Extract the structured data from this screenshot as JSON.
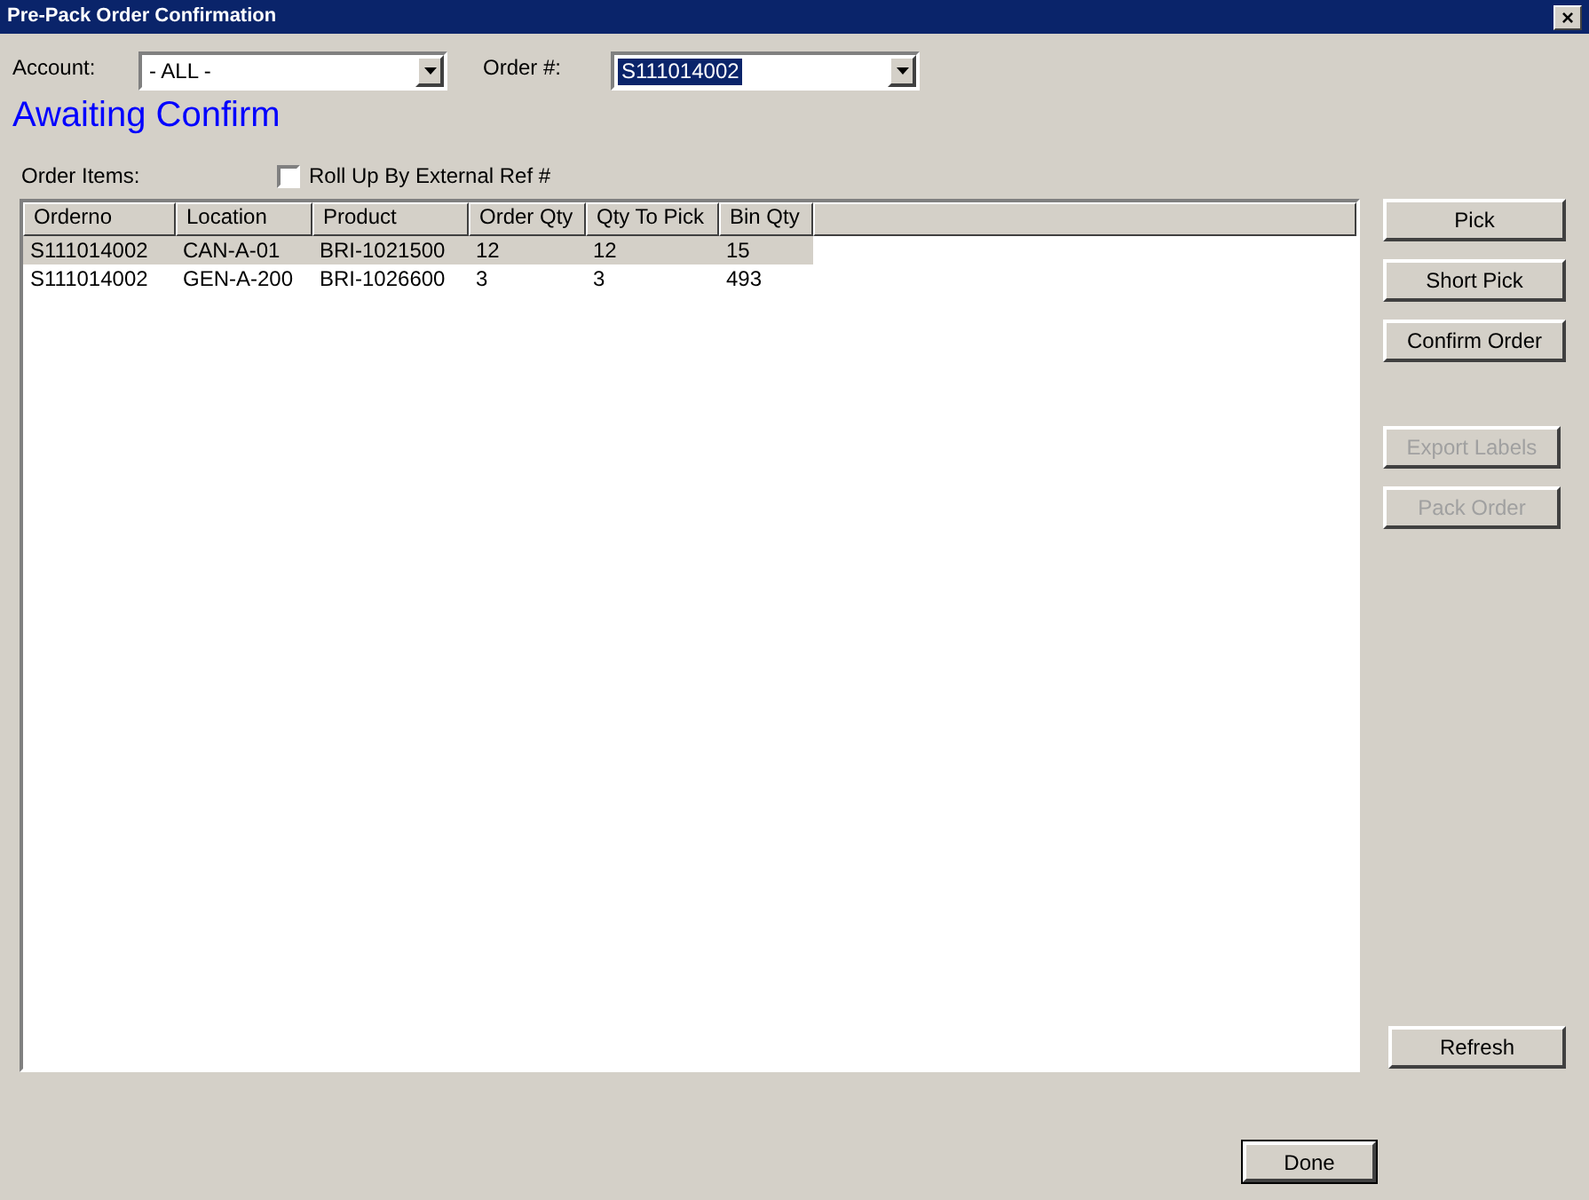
{
  "window": {
    "title": "Pre-Pack Order Confirmation",
    "close": "×"
  },
  "account": {
    "label": "Account:",
    "value": "- ALL -",
    "selected": false
  },
  "order": {
    "label": "Order #:",
    "value": "S111014002",
    "selected": true
  },
  "status": "Awaiting Confirm",
  "items_label": "Order Items:",
  "rollup": {
    "label": "Roll Up By External Ref #",
    "checked": false
  },
  "table": {
    "columns": [
      "Orderno",
      "Location",
      "Product",
      "Order Qty",
      "Qty To Pick",
      "Bin Qty"
    ],
    "rows": [
      {
        "cells": [
          "S111014002",
          "CAN-A-01",
          "BRI-1021500",
          "12",
          "12",
          "15"
        ],
        "selected": true
      },
      {
        "cells": [
          "S111014002",
          "GEN-A-200",
          "BRI-1026600",
          "3",
          "3",
          "493"
        ],
        "selected": false
      }
    ]
  },
  "actions": [
    {
      "label": "Pick",
      "disabled": false
    },
    {
      "label": "Short Pick",
      "disabled": false
    },
    {
      "label": "Confirm Order",
      "disabled": false
    },
    {
      "label": "Export Labels",
      "disabled": true
    },
    {
      "label": "Pack Order",
      "disabled": true
    }
  ],
  "refresh": {
    "label": "Refresh",
    "disabled": false
  },
  "done": {
    "label": "Done",
    "default": true
  }
}
